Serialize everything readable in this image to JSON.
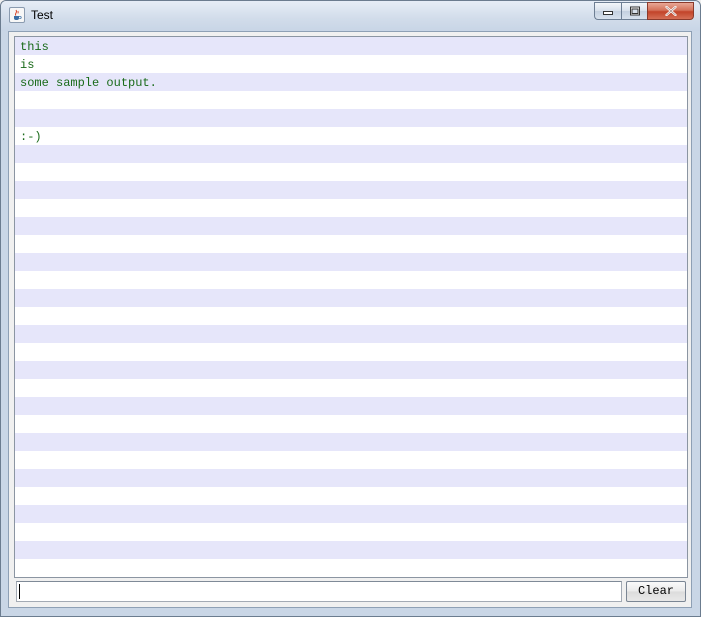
{
  "window": {
    "title": "Test",
    "app_icon": "java-coffee-cup-icon",
    "controls": {
      "minimize_icon": "minimize-icon",
      "maximize_icon": "maximize-icon",
      "close_icon": "close-icon"
    }
  },
  "output": {
    "text_color": "#1a6b1a",
    "stripe_colors": [
      "#e6e6fa",
      "#ffffff"
    ],
    "lines": [
      "this",
      "is",
      "some sample output.",
      "",
      "",
      ":-)"
    ]
  },
  "input": {
    "value": "",
    "placeholder": ""
  },
  "buttons": {
    "clear_label": "Clear"
  }
}
